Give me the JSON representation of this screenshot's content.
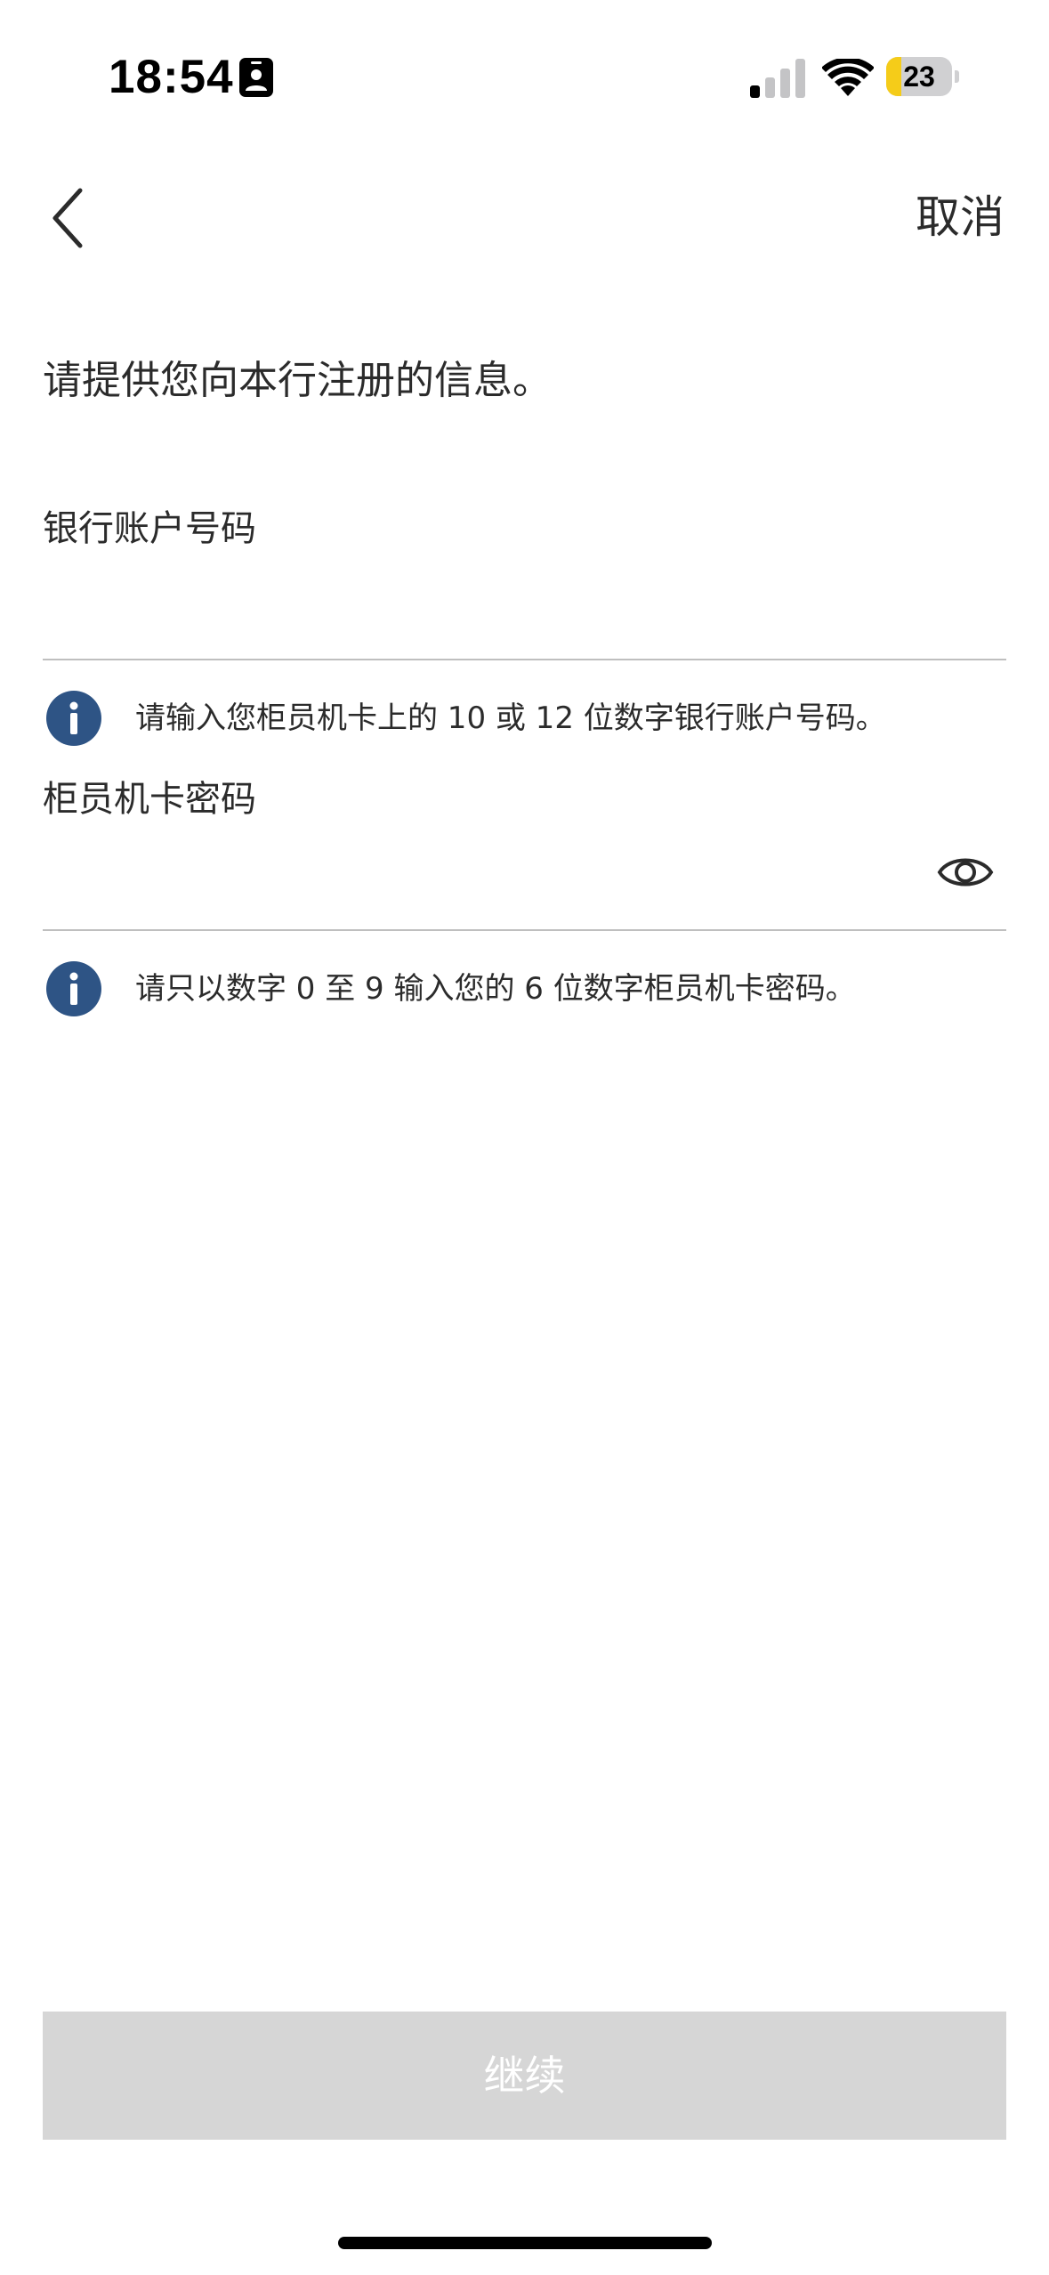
{
  "status_bar": {
    "time": "18:54",
    "battery_level": "23",
    "battery_fraction": 0.23,
    "signal_bars_active": 1,
    "signal_bars_total": 4
  },
  "nav": {
    "back_icon": "chevron-left-icon",
    "cancel_label": "取消"
  },
  "intro": {
    "text": "请提供您向本行注册的信息。"
  },
  "account_field": {
    "label": "银行账户号码",
    "value": "",
    "hint": "请输入您柜员机卡上的 10 或 12 位数字银行账户号码。",
    "hint_icon": "info-icon"
  },
  "pin_field": {
    "label": "柜员机卡密码",
    "value": "",
    "toggle_icon": "eye-icon",
    "hint": "请只以数字 0 至 9 输入您的 6 位数字柜员机卡密码。",
    "hint_icon": "info-icon"
  },
  "actions": {
    "continue_label": "继续"
  },
  "colors": {
    "info_icon": "#2e5485",
    "battery_fill": "#f5cc19",
    "button_disabled": "#d6d6d6",
    "divider": "#bfbfbf"
  }
}
